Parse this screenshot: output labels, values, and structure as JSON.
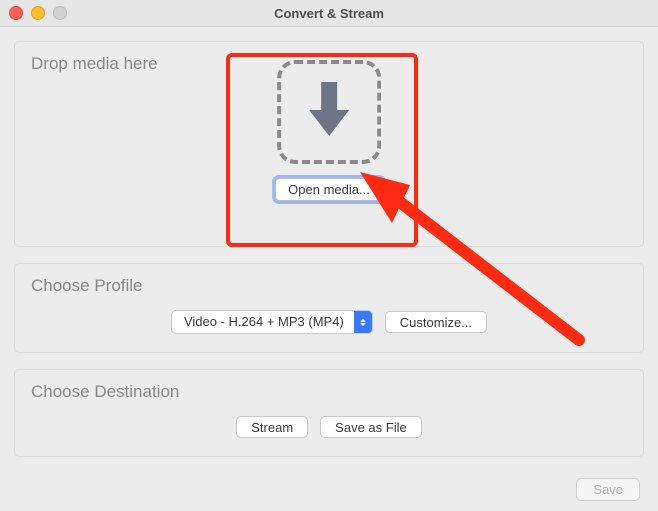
{
  "window": {
    "title": "Convert & Stream"
  },
  "drop_panel": {
    "heading": "Drop media here",
    "open_media_label": "Open media..."
  },
  "profile_panel": {
    "heading": "Choose Profile",
    "selected_profile": "Video - H.264 + MP3 (MP4)",
    "customize_label": "Customize..."
  },
  "destination_panel": {
    "heading": "Choose Destination",
    "stream_label": "Stream",
    "save_as_file_label": "Save as File"
  },
  "footer": {
    "save_label": "Save"
  },
  "annotation": {
    "color": "#ff2a12"
  }
}
